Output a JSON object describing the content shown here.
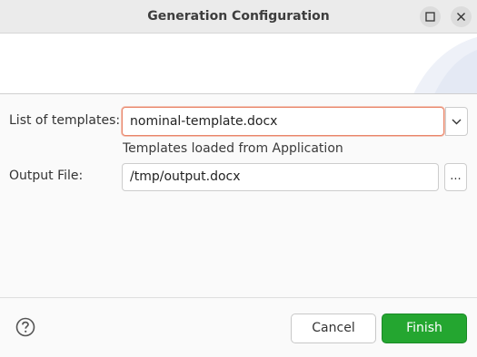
{
  "window": {
    "title": "Generation Configuration"
  },
  "form": {
    "templates_label": "List of templates:",
    "templates_value": "nominal-template.docx",
    "templates_hint": "Templates loaded from Application",
    "output_label": "Output File:",
    "output_value": "/tmp/output.docx",
    "browse_label": "..."
  },
  "footer": {
    "cancel_label": "Cancel",
    "finish_label": "Finish",
    "finish_color": "#24a630"
  },
  "icons": {
    "maximize": "maximize-icon",
    "close": "close-icon",
    "dropdown": "chevron-down-icon",
    "help": "help-icon"
  }
}
